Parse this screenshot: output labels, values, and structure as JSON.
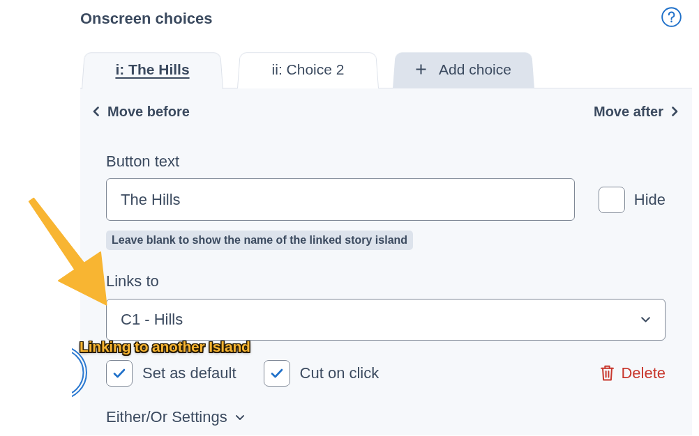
{
  "header": {
    "title": "Onscreen choices"
  },
  "tabs": [
    {
      "kind": "choice",
      "label": "i: The Hills",
      "selected": true
    },
    {
      "kind": "choice",
      "label": "ii: Choice 2",
      "selected": false
    },
    {
      "kind": "add",
      "label": "Add choice",
      "selected": false
    }
  ],
  "move": {
    "before": "Move before",
    "after": "Move after"
  },
  "button_text": {
    "label": "Button text",
    "value": "The Hills",
    "hint": "Leave blank to show the name of the linked story island"
  },
  "hide": {
    "label": "Hide",
    "checked": false
  },
  "links_to": {
    "label": "Links to",
    "value": "C1 - Hills"
  },
  "options": [
    {
      "label": "Set as default",
      "checked": true
    },
    {
      "label": "Cut on click",
      "checked": true
    }
  ],
  "delete": {
    "label": "Delete"
  },
  "either_or": {
    "label": "Either/Or Settings",
    "expanded": false
  },
  "annotation": {
    "label": "Linking to another Island"
  }
}
